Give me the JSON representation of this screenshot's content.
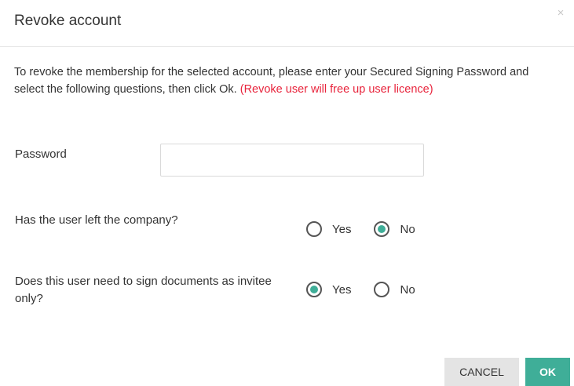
{
  "dialog": {
    "title": "Revoke account",
    "close_glyph": "×",
    "close_icon": "close-icon",
    "intro_text": "To revoke the membership for the selected account, please enter your Secured Signing Password and select the following questions, then click Ok.",
    "intro_warning": "(Revoke user will free up user licence)",
    "warning_color": "#e8243c"
  },
  "password": {
    "label": "Password",
    "value": "",
    "placeholder": ""
  },
  "questions": [
    {
      "text": "Has the user left the company?",
      "options": [
        "Yes",
        "No"
      ],
      "selected": "No"
    },
    {
      "text": "Does this user need to sign documents as invitee only?",
      "options": [
        "Yes",
        "No"
      ],
      "selected": "Yes"
    }
  ],
  "buttons": {
    "cancel_label": "CANCEL",
    "ok_label": "OK"
  },
  "colors": {
    "accent": "#3fae98",
    "cancel_bg": "#e4e4e4"
  }
}
